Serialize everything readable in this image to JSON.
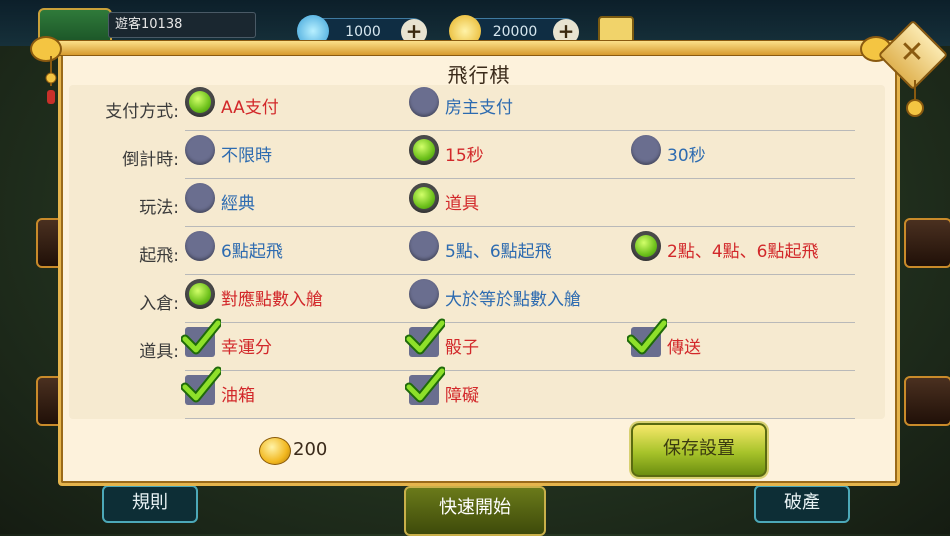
{
  "hud": {
    "username": "遊客10138",
    "diamonds": "1000",
    "gold": "20000"
  },
  "bottom": {
    "rules": "規則",
    "quick_start": "快速開始",
    "bankrupt": "破產"
  },
  "panel": {
    "title": "飛行棋",
    "rows": [
      {
        "label": "支付方式:",
        "type": "radio",
        "options": [
          {
            "text": "AA支付",
            "selected": true
          },
          {
            "text": "房主支付",
            "selected": false
          }
        ]
      },
      {
        "label": "倒計時:",
        "type": "radio",
        "options": [
          {
            "text": "不限時",
            "selected": false
          },
          {
            "text": "15秒",
            "selected": true
          },
          {
            "text": "30秒",
            "selected": false
          }
        ]
      },
      {
        "label": "玩法:",
        "type": "radio",
        "options": [
          {
            "text": "經典",
            "selected": false
          },
          {
            "text": "道具",
            "selected": true
          }
        ]
      },
      {
        "label": "起飛:",
        "type": "radio",
        "options": [
          {
            "text": "6點起飛",
            "selected": false
          },
          {
            "text": "5點、6點起飛",
            "selected": false
          },
          {
            "text": "2點、4點、6點起飛",
            "selected": true
          }
        ]
      },
      {
        "label": "入倉:",
        "type": "radio",
        "options": [
          {
            "text": "對應點數入艙",
            "selected": true
          },
          {
            "text": "大於等於點數入艙",
            "selected": false
          }
        ]
      },
      {
        "label": "道具:",
        "type": "checkbox",
        "options": [
          {
            "text": "幸運分",
            "selected": true
          },
          {
            "text": "骰子",
            "selected": true
          },
          {
            "text": "傳送",
            "selected": true
          }
        ]
      },
      {
        "label": "",
        "type": "checkbox",
        "options": [
          {
            "text": "油箱",
            "selected": true
          },
          {
            "text": "障礙",
            "selected": true
          }
        ]
      }
    ],
    "cost": "200",
    "save_label": "保存設置"
  },
  "colors": {
    "selected_text": "#d2282a",
    "unselected_text": "#2d6bb0",
    "panel_bg": "#fdf2dc",
    "accent_gold": "#e5b44c"
  }
}
